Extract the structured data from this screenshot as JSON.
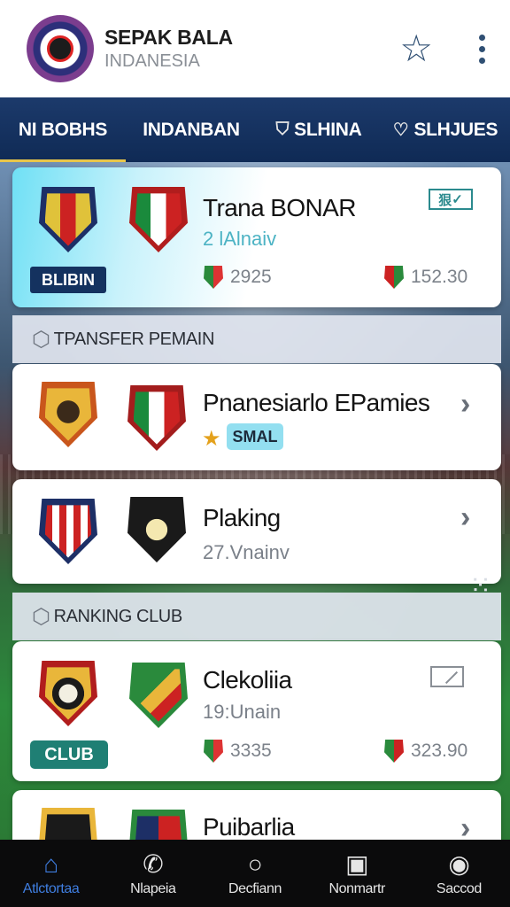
{
  "header": {
    "title": "SEPAK BALA",
    "subtitle": "INDANESIA",
    "star_icon": "star-outline-icon",
    "menu_icon": "kebab-menu-icon"
  },
  "tabs": [
    {
      "label": "NI BOBHS",
      "active": true
    },
    {
      "label": "INDANBAN",
      "active": false
    },
    {
      "label": "SLHINA",
      "icon": "shield-icon"
    },
    {
      "label": "SLHJUES",
      "icon": "crest-icon"
    }
  ],
  "cards": {
    "match1": {
      "title": "Trana BONAR",
      "subtitle": "2 lAlnaiv",
      "badge": "BLIBIN",
      "stat1": "2925",
      "stat2": "152.30",
      "tag_icon_text": "狠",
      "tag_icon_check": "✓"
    },
    "transfer1": {
      "title": "Pnanesiarlo EPamies",
      "badge": "SMAL",
      "star": "★"
    },
    "transfer2": {
      "title": "Plaking",
      "subtitle": "27.Vnainv"
    },
    "ranking1": {
      "title": "Clekoliia",
      "subtitle": "19:Unain",
      "badge": "CLUB",
      "stat1": "3335",
      "stat2": "323.90"
    },
    "ranking2": {
      "title": "Puibarlia"
    }
  },
  "sections": {
    "transfer": "TPANSFER PEMAIN",
    "ranking": "RANKING CLUB"
  },
  "bottom_nav": [
    {
      "label": "Atlctortaa",
      "icon": "home-icon",
      "active": true
    },
    {
      "label": "Nlapeia",
      "icon": "phone-icon"
    },
    {
      "label": "Decfiann",
      "icon": "circle-icon"
    },
    {
      "label": "Nonmartr",
      "icon": "id-card-icon"
    },
    {
      "label": "Saccod",
      "icon": "user-icon"
    }
  ],
  "colors": {
    "header_bg": "#ffffff",
    "tabs_bg": "#0f2a55",
    "tab_indicator": "#e9c64a",
    "nav_bg": "#0b0b0c",
    "nav_active": "#3f7ee0",
    "badge_dark": "#14325f",
    "badge_green": "#1f7f74",
    "badge_cyan": "#93dff0"
  }
}
